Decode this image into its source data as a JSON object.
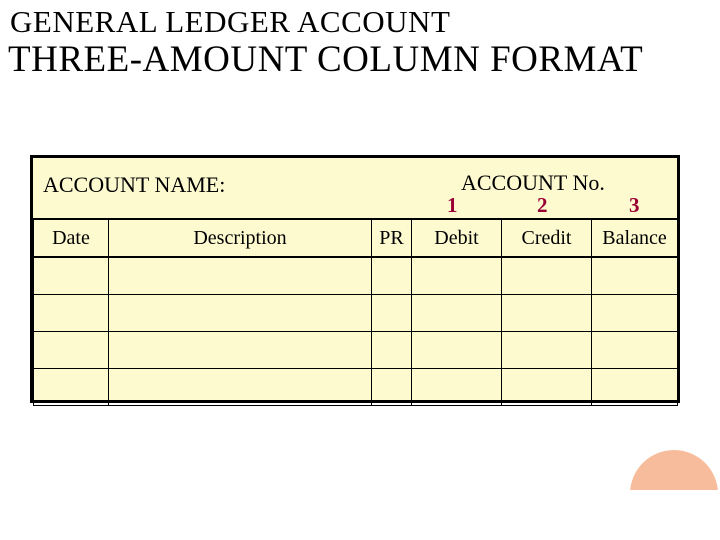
{
  "title": {
    "line1": "GENERAL LEDGER ACCOUNT",
    "line2": "THREE-AMOUNT COLUMN FORMAT"
  },
  "ledger": {
    "account_name_label": "ACCOUNT NAME:",
    "account_no_label": "ACCOUNT No.",
    "columns": {
      "date": "Date",
      "description": "Description",
      "pr": "PR",
      "debit": "Debit",
      "credit": "Credit",
      "balance": "Balance"
    },
    "annotations": {
      "a1": "1",
      "a2": "2",
      "a3": "3"
    },
    "rows": [
      {
        "date": "",
        "description": "",
        "pr": "",
        "debit": "",
        "credit": "",
        "balance": ""
      },
      {
        "date": "",
        "description": "",
        "pr": "",
        "debit": "",
        "credit": "",
        "balance": ""
      },
      {
        "date": "",
        "description": "",
        "pr": "",
        "debit": "",
        "credit": "",
        "balance": ""
      },
      {
        "date": "",
        "description": "",
        "pr": "",
        "debit": "",
        "credit": "",
        "balance": ""
      }
    ]
  },
  "colors": {
    "background": "#fdfad0",
    "annotation": "#990033",
    "circle": "#f6b08a"
  }
}
